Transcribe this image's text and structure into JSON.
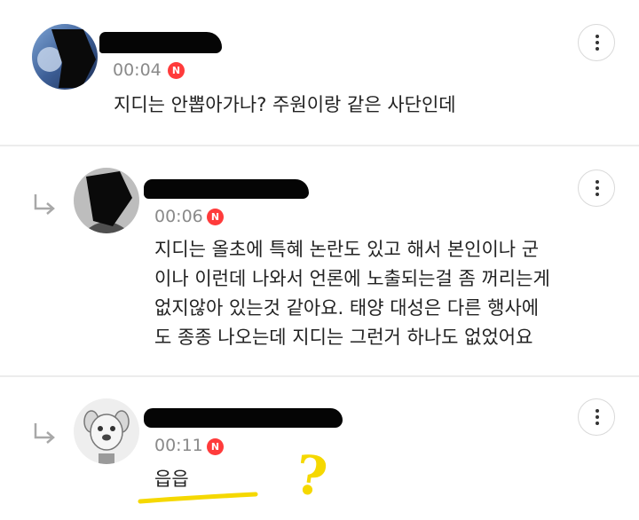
{
  "comments": [
    {
      "time": "00:04",
      "badge": "N",
      "text": "지디는 안뽑아가나? 주원이랑 같은 사단인데",
      "is_reply": false
    },
    {
      "time": "00:06",
      "badge": "N",
      "text_lines": [
        "지디는 올초에 특혜 논란도 있고 해서 본인이나 군",
        "이나 이런데 나와서 언론에 노출되는걸 좀 꺼리는게",
        "없지않아 있는것 같아요. 태양 대성은 다른 행사에",
        "도 종종 나오는데 지디는 그런거 하나도 없었어요"
      ],
      "is_reply": true
    },
    {
      "time": "00:11",
      "badge": "N",
      "text": "읍읍",
      "is_reply": true,
      "annotation": "?"
    }
  ],
  "colors": {
    "badge": "#ff3b3b",
    "time": "#8a8a8a",
    "highlight": "#f5d800",
    "redaction": "#050505"
  },
  "icons": [
    "more-vertical-icon",
    "reply-arrow-icon"
  ]
}
